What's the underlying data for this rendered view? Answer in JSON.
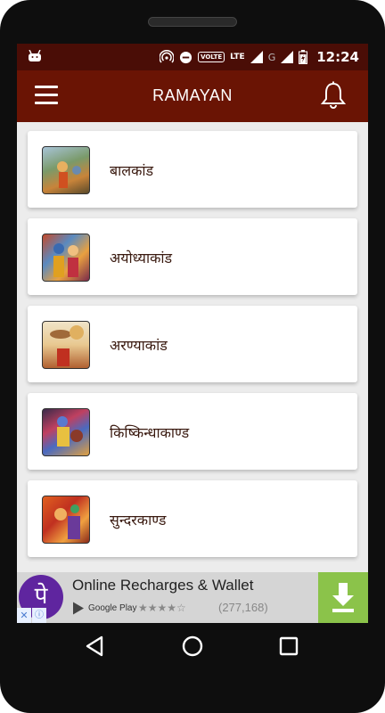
{
  "status_bar": {
    "time": "12:24",
    "volte": "VOLTE",
    "lte": "LTE",
    "network_g": "G",
    "icons": [
      "android-icon",
      "hotspot-icon",
      "dnd-icon",
      "signal-icon",
      "battery-charging-icon"
    ]
  },
  "app_bar": {
    "title": "RAMAYAN",
    "menu_icon": "hamburger-menu-icon",
    "bell_icon": "bell-icon"
  },
  "list": {
    "items": [
      {
        "label": "बालकांड"
      },
      {
        "label": "अयोध्याकांड"
      },
      {
        "label": "अरण्याकांड"
      },
      {
        "label": "किष्किन्धाकाण्ड"
      },
      {
        "label": "सुन्दरकाण्ड"
      }
    ]
  },
  "ad": {
    "logo_text": "पे",
    "title": "Online Recharges & Wallet",
    "store": "Google Play",
    "rating_stars": "★★★★☆",
    "rating_count": "(277,168)",
    "accent": "#5f259f",
    "download_color": "#8bc34a"
  },
  "colors": {
    "status_bar": "#4a0d06",
    "app_bar": "#6a1404",
    "background": "#ececec"
  }
}
